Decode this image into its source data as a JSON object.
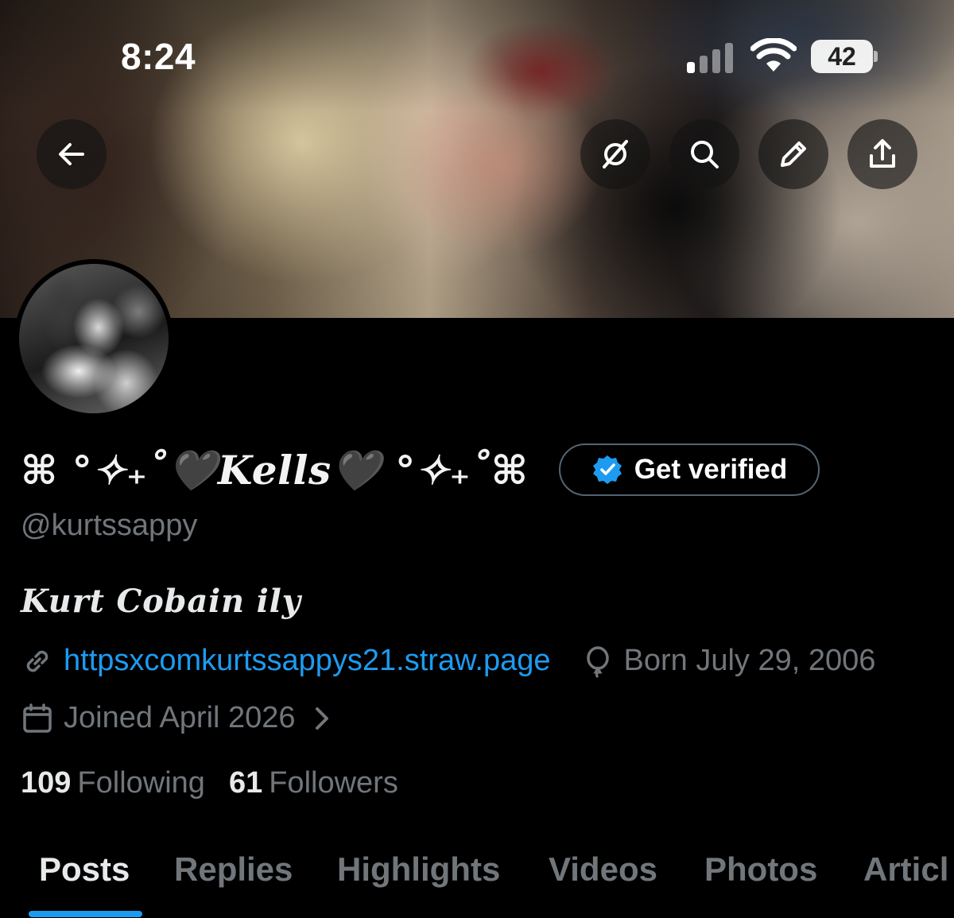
{
  "status_bar": {
    "time": "8:24",
    "battery": "42"
  },
  "profile": {
    "display_name": "⌘ °✧₊˚🖤Kells🖤 °✧₊˚⌘",
    "handle": "@kurtssappy",
    "bio": "Kurt Cobain ily",
    "website": "httpsxcomkurtssappys21.straw.page",
    "birthday": "Born July 29, 2006",
    "joined": "Joined April 2026",
    "get_verified_label": "Get verified"
  },
  "stats": {
    "following_count": "109",
    "following_label": "Following",
    "followers_count": "61",
    "followers_label": "Followers"
  },
  "tabs": [
    {
      "label": "Posts",
      "active": true
    },
    {
      "label": "Replies"
    },
    {
      "label": "Highlights"
    },
    {
      "label": "Videos"
    },
    {
      "label": "Photos"
    },
    {
      "label": "Articl"
    }
  ],
  "colors": {
    "accent": "#1d9bf0",
    "muted": "#71767b",
    "text": "#e7e9ea"
  },
  "icons": [
    "back-arrow-icon",
    "grok-icon",
    "search-icon",
    "edit-pencil-icon",
    "share-icon",
    "verified-badge-icon",
    "link-icon",
    "balloon-icon",
    "calendar-icon",
    "chevron-right-icon"
  ]
}
